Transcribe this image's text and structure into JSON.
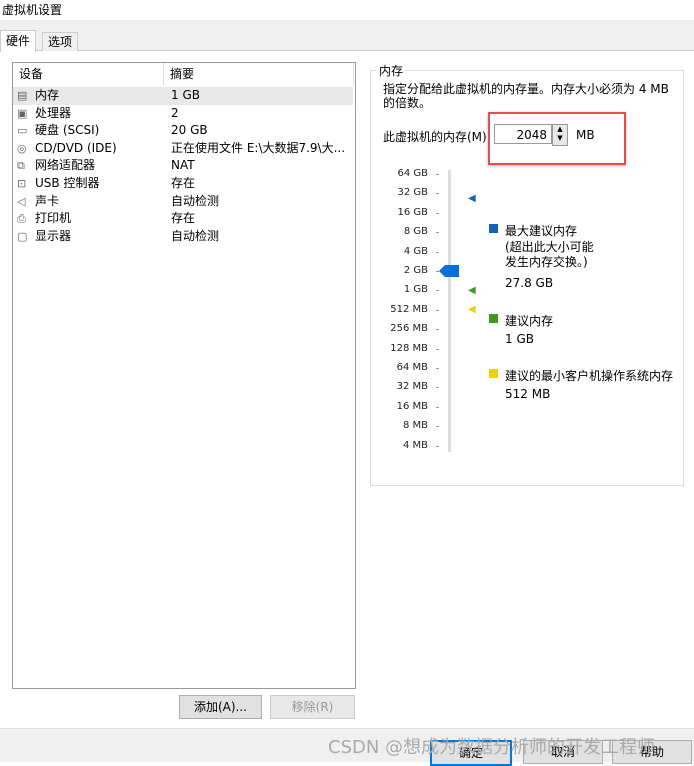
{
  "window": {
    "title": "虚拟机设置"
  },
  "tabs": [
    {
      "label": "硬件",
      "active": true
    },
    {
      "label": "选项",
      "active": false
    }
  ],
  "device_list": {
    "headers": [
      "设备",
      "摘要"
    ],
    "rows": [
      {
        "icon": "memory-icon",
        "device": "内存",
        "summary": "1 GB",
        "selected": true
      },
      {
        "icon": "cpu-icon",
        "device": "处理器",
        "summary": "2"
      },
      {
        "icon": "disk-icon",
        "device": "硬盘 (SCSI)",
        "summary": "20 GB"
      },
      {
        "icon": "cd-icon",
        "device": "CD/DVD (IDE)",
        "summary": "正在使用文件 E:\\大数据7.9\\大..."
      },
      {
        "icon": "network-icon",
        "device": "网络适配器",
        "summary": "NAT"
      },
      {
        "icon": "usb-icon",
        "device": "USB 控制器",
        "summary": "存在"
      },
      {
        "icon": "speaker-icon",
        "device": "声卡",
        "summary": "自动检测"
      },
      {
        "icon": "printer-icon",
        "device": "打印机",
        "summary": "存在"
      },
      {
        "icon": "monitor-icon",
        "device": "显示器",
        "summary": "自动检测"
      }
    ],
    "add_button": "添加(A)...",
    "remove_button": "移除(R)"
  },
  "memory": {
    "group_label": "内存",
    "description": "指定分配给此虚拟机的内存量。内存大小必须为 4 MB 的倍数。",
    "field_label": "此虚拟机的内存(M):",
    "value": "2048",
    "unit": "MB",
    "scale": [
      "64 GB",
      "32 GB",
      "16 GB",
      "8 GB",
      "4 GB",
      "2 GB",
      "1 GB",
      "512 MB",
      "256 MB",
      "128 MB",
      "64 MB",
      "32 MB",
      "16 MB",
      "8 MB",
      "4 MB"
    ],
    "slider_value_label": "2 GB",
    "legend": [
      {
        "label": "最大建议内存",
        "note": "(超出此大小可能\n发生内存交换。)",
        "value": "27.8 GB",
        "color": "#1464b4"
      },
      {
        "label": "建议内存",
        "value": "1 GB",
        "color": "#3c9a1e"
      },
      {
        "label": "建议的最小客户机操作系统内存",
        "value": "512 MB",
        "color": "#f0d000"
      }
    ]
  },
  "footer": {
    "ok": "确定",
    "cancel": "取消",
    "help": "帮助"
  },
  "watermark": "CSDN @想成为数据分析师的开发工程师"
}
